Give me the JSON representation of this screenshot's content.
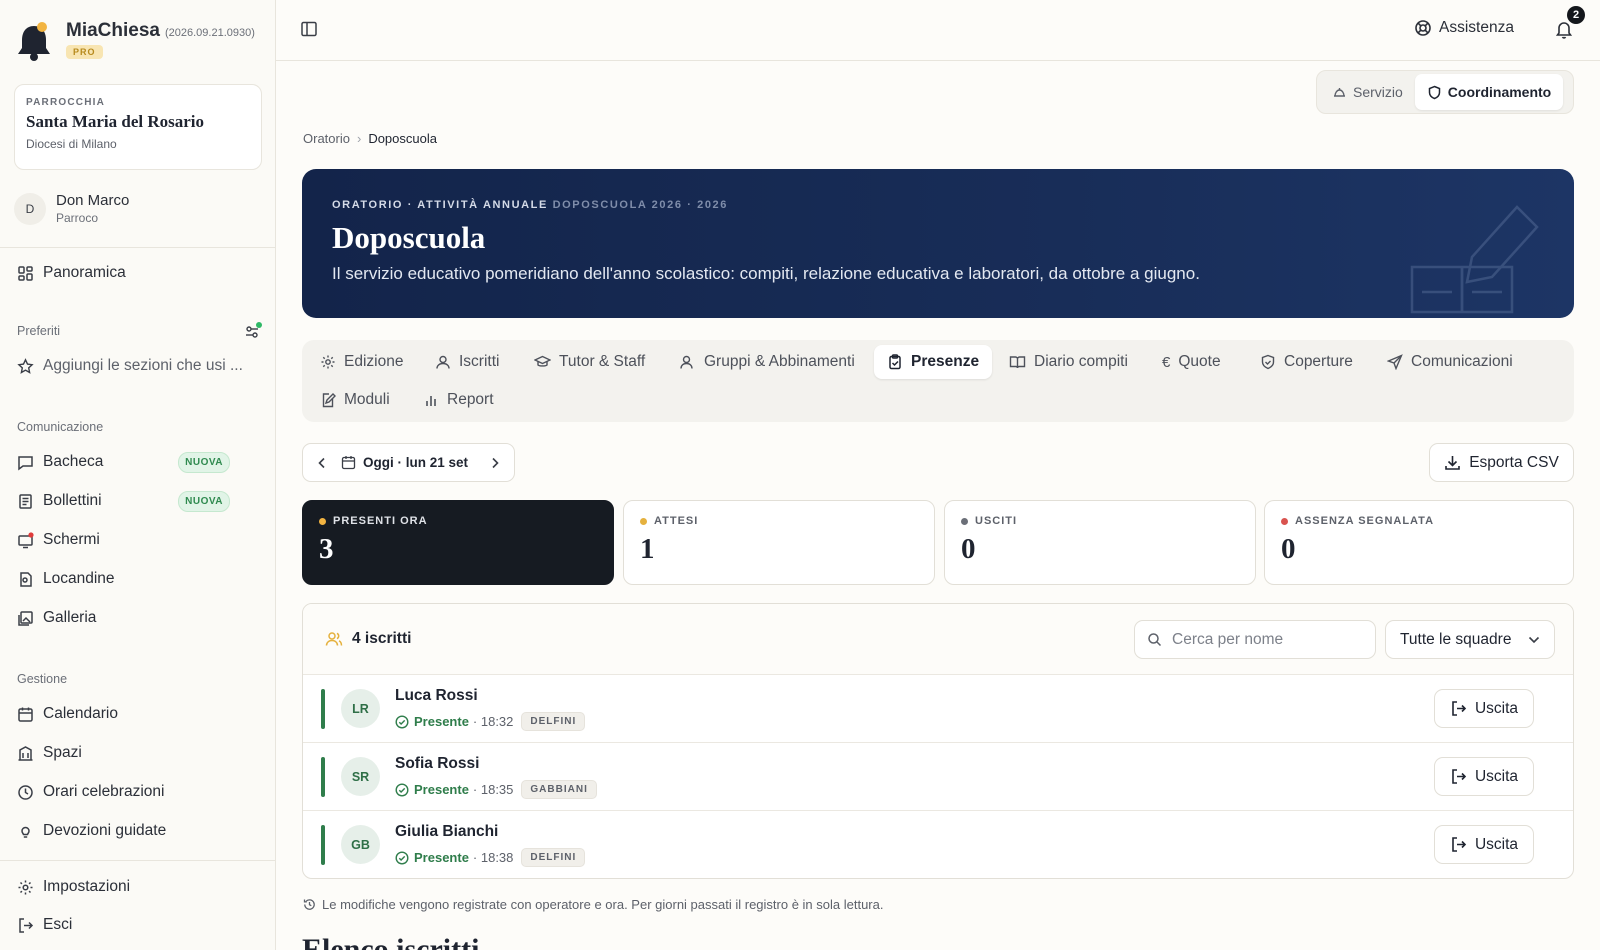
{
  "app": {
    "name": "MiaChiesa",
    "version": "(2026.09.21.0930)",
    "plan_badge": "PRO"
  },
  "parish": {
    "kicker": "PARROCCHIA",
    "name": "Santa Maria del Rosario",
    "diocese": "Diocesi di Milano"
  },
  "user": {
    "initial": "D",
    "name": "Don Marco",
    "role": "Parroco"
  },
  "sidebar": {
    "overview": "Panoramica",
    "favorites_title": "Preferiti",
    "favorites_hint": "Aggiungi le sezioni che usi ...",
    "communication_title": "Comunicazione",
    "communication_items": [
      {
        "label": "Bacheca",
        "badge": "NUOVA"
      },
      {
        "label": "Bollettini",
        "badge": "NUOVA"
      },
      {
        "label": "Schermi"
      },
      {
        "label": "Locandine"
      },
      {
        "label": "Galleria"
      }
    ],
    "management_title": "Gestione",
    "management_items": [
      {
        "label": "Calendario"
      },
      {
        "label": "Spazi"
      },
      {
        "label": "Orari celebrazioni"
      },
      {
        "label": "Devozioni guidate"
      }
    ],
    "settings": "Impostazioni",
    "logout": "Esci"
  },
  "header": {
    "help": "Assistenza",
    "notifications_count": "2"
  },
  "mode_switch": {
    "service": "Servizio",
    "coordination": "Coordinamento",
    "active": "coordination"
  },
  "breadcrumb": {
    "parent": "Oratorio",
    "current": "Doposcuola"
  },
  "hero": {
    "kicker_main": "ORATORIO · ATTIVITÀ ANNUALE",
    "kicker_sub": "DOPOSCUOLA 2026 · 2026",
    "title": "Doposcuola",
    "description": "Il servizio educativo pomeridiano dell'anno scolastico: compiti, relazione educativa e laboratori, da ottobre a giugno."
  },
  "tabs": [
    {
      "label": "Edizione"
    },
    {
      "label": "Iscritti"
    },
    {
      "label": "Tutor & Staff"
    },
    {
      "label": "Gruppi & Abbinamenti"
    },
    {
      "label": "Presenze",
      "active": true
    },
    {
      "label": "Diario compiti"
    },
    {
      "label": "Quote"
    },
    {
      "label": "Coperture"
    },
    {
      "label": "Comunicazioni"
    },
    {
      "label": "Moduli"
    },
    {
      "label": "Report"
    }
  ],
  "date_nav": {
    "label": "Oggi · lun 21 set"
  },
  "export": {
    "label": "Esporta CSV"
  },
  "stats": [
    {
      "label": "PRESENTI ORA",
      "value": "3",
      "dot": "#f2b441"
    },
    {
      "label": "ATTESI",
      "value": "1",
      "dot": "#e5b13e"
    },
    {
      "label": "USCITI",
      "value": "0",
      "dot": "#6b6f78"
    },
    {
      "label": "ASSENZA SEGNALATA",
      "value": "0",
      "dot": "#d9534f"
    }
  ],
  "roster": {
    "count_label": "4 iscritti",
    "search_placeholder": "Cerca per nome",
    "team_filter": "Tutte le squadre",
    "exit_label": "Uscita",
    "rows": [
      {
        "initials": "LR",
        "name": "Luca Rossi",
        "status": "Presente",
        "time": "· 18:32",
        "team": "DELFINI"
      },
      {
        "initials": "SR",
        "name": "Sofia Rossi",
        "status": "Presente",
        "time": "· 18:35",
        "team": "GABBIANI"
      },
      {
        "initials": "GB",
        "name": "Giulia Bianchi",
        "status": "Presente",
        "time": "· 18:38",
        "team": "DELFINI"
      }
    ]
  },
  "footnote": "Le modifiche vengono registrate con operatore e ora. Per giorni passati il registro è in sola lettura.",
  "next_section_heading": "Elenco iscritti",
  "colors": {
    "accent_navy": "#13244a",
    "present_green": "#2f7d4b",
    "new_badge_green": "#2f8a4f",
    "pro_gold": "#b78a1d"
  }
}
